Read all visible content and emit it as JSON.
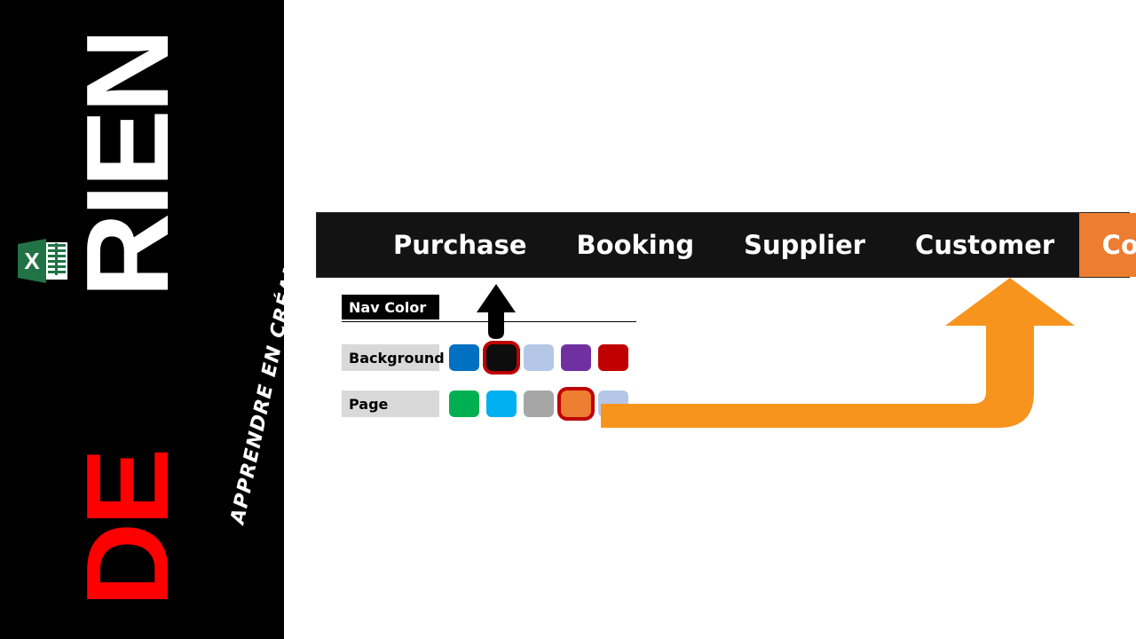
{
  "sidebar": {
    "brand_line_1": "RIEN",
    "brand_line_2": "DE",
    "tagline": "APPRENDRE EN CRÉANT POUR MAÎTRISER",
    "excel_icon_letter": "X",
    "colors": {
      "background": "#000000",
      "brand_line_1_color": "#FFFFFF",
      "brand_line_2_color": "#FF0000",
      "excel_green": "#217346"
    }
  },
  "navbar": {
    "background": "#131313",
    "active_color": "#ED7D31",
    "items": [
      {
        "label": "Purchase",
        "active": false
      },
      {
        "label": "Booking",
        "active": false
      },
      {
        "label": "Supplier",
        "active": false
      },
      {
        "label": "Customer",
        "active": false
      },
      {
        "label": "Config",
        "active": true
      }
    ]
  },
  "config_panel": {
    "header": {
      "label": "Nav Color",
      "bg": "#000000",
      "fg": "#FFFFFF"
    },
    "rows": [
      {
        "label": "Background",
        "label_bg": "#D9D9D9",
        "swatches": [
          {
            "name": "blue",
            "color": "#0070C0",
            "selected": false
          },
          {
            "name": "black",
            "color": "#0D0D0D",
            "selected": true
          },
          {
            "name": "light-blue",
            "color": "#B4C7E7",
            "selected": false
          },
          {
            "name": "purple",
            "color": "#7030A0",
            "selected": false
          },
          {
            "name": "dark-red",
            "color": "#C00000",
            "selected": false
          }
        ]
      },
      {
        "label": "Page",
        "label_bg": "#D9D9D9",
        "swatches": [
          {
            "name": "green",
            "color": "#00B050",
            "selected": false
          },
          {
            "name": "cyan",
            "color": "#00B0F0",
            "selected": false
          },
          {
            "name": "gray",
            "color": "#A6A6A6",
            "selected": false
          },
          {
            "name": "orange",
            "color": "#ED7D31",
            "selected": true
          },
          {
            "name": "light-blue",
            "color": "#B4C7E7",
            "selected": false
          }
        ]
      }
    ],
    "selection_border_color": "#C00000"
  },
  "annotations": {
    "black_arrow": {
      "direction": "up",
      "color": "#000000"
    },
    "orange_arrow": {
      "direction": "up",
      "color": "#F7941E",
      "shape": "elbow-curved"
    }
  }
}
